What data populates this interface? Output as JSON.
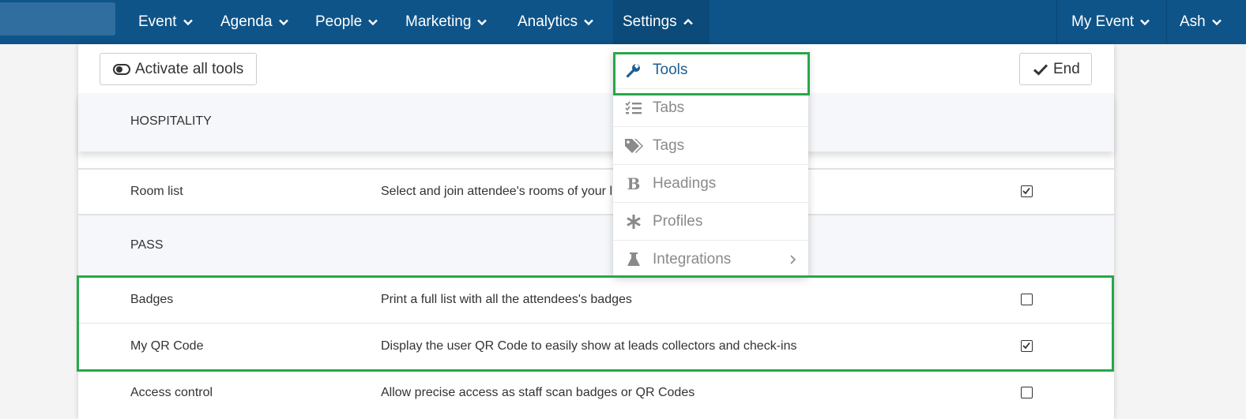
{
  "nav": {
    "items": [
      {
        "label": "Event"
      },
      {
        "label": "Agenda"
      },
      {
        "label": "People"
      },
      {
        "label": "Marketing"
      },
      {
        "label": "Analytics"
      },
      {
        "label": "Settings",
        "state": "expanded"
      }
    ],
    "right": [
      {
        "label": "My Event"
      },
      {
        "label": "Ash"
      }
    ]
  },
  "toolbar": {
    "activate_label": "Activate all tools",
    "end_label": "End"
  },
  "settings_menu": [
    {
      "label": "Tools",
      "icon": "wrench-icon",
      "active": true
    },
    {
      "label": "Tabs",
      "icon": "list-icon"
    },
    {
      "label": "Tags",
      "icon": "tags-icon"
    },
    {
      "label": "Headings",
      "icon": "bold-icon"
    },
    {
      "label": "Profiles",
      "icon": "asterisk-icon"
    },
    {
      "label": "Integrations",
      "icon": "flask-icon",
      "has_submenu": true
    }
  ],
  "sections": [
    {
      "title": "HOSPITALITY",
      "tools": [
        {
          "name": "Room list",
          "description": "Select and join attendee's rooms of your l",
          "checked": true
        }
      ]
    },
    {
      "title": "PASS",
      "tools": [
        {
          "name": "Badges",
          "description": "Print a full list with all the attendees's badges",
          "checked": false
        },
        {
          "name": "My QR Code",
          "description": "Display the user QR Code to easily show at leads collectors and check-ins",
          "checked": true
        },
        {
          "name": "Access control",
          "description": "Allow precise access as staff scan badges or QR Codes",
          "checked": false
        }
      ]
    }
  ],
  "colors": {
    "navbar": "#0e5489",
    "highlight": "#27a849",
    "active_menu_text": "#1b5e92"
  }
}
